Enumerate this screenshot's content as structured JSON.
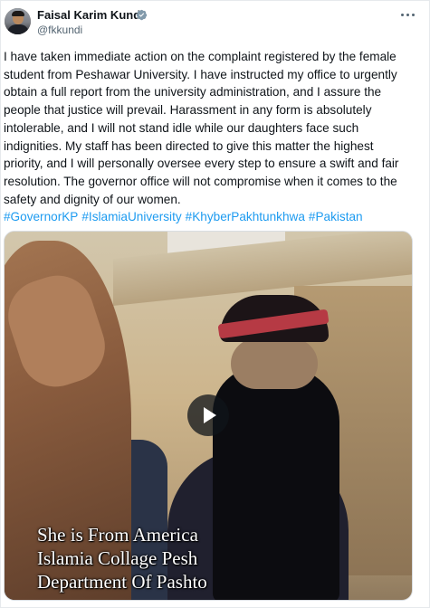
{
  "author": {
    "name": "Faisal Karim Kundi",
    "handle": "@fkkundi",
    "verified": true,
    "avatar_icon": "profile-photo"
  },
  "post": {
    "lines": [
      "I have taken immediate action on the complaint registered by the female",
      "student from Peshawar University. I have instructed my office to urgently",
      "obtain a full report from the university administration, and I assure the",
      "people that justice will prevail. Harassment in any form is absolutely",
      "intolerable, and I will not stand idle while our daughters face such",
      "indignities. My staff has been directed to give this matter the highest",
      "priority, and I will personally oversee every step to ensure a swift and fair",
      "resolution. The governor office will not compromise when it comes to the",
      "safety and dignity of our women."
    ],
    "hashtags": [
      "#GovernorKP",
      "#IslamiaUniversity",
      "#KhyberPakhtunkhwa",
      "#Pakistan"
    ]
  },
  "video": {
    "caption_lines": [
      "She is From America",
      "Islamia Collage Pesh",
      "Department Of Pashto"
    ],
    "play_icon": "play-icon"
  },
  "colors": {
    "text": "#0f1419",
    "secondary": "#536471",
    "link": "#1d9bf0",
    "verified": "#829aab"
  }
}
